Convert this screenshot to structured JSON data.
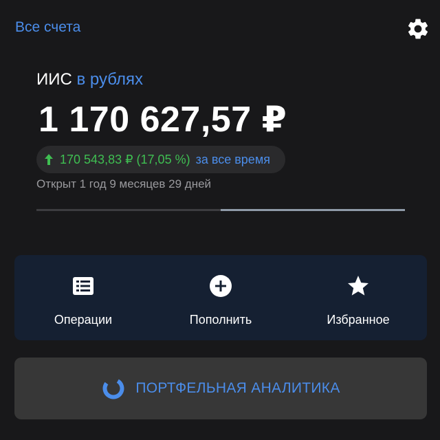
{
  "header": {
    "all_accounts_label": "Все счета",
    "settings_icon": "gear-icon"
  },
  "account": {
    "name": "ИИС",
    "currency_label": "в рублях",
    "balance": "1 170 627,57 ₽",
    "change": {
      "direction": "up",
      "value": "170 543,83 ₽ (17,05 %)",
      "period_label": "за все время",
      "color": "#3fbf52"
    },
    "opened_text": "Открыт 1 год 9 месяцев 29 дней",
    "progress_fraction": 0.5
  },
  "actions": [
    {
      "label": "Операции",
      "icon": "list-icon"
    },
    {
      "label": "Пополнить",
      "icon": "plus-circle-icon"
    },
    {
      "label": "Избранное",
      "icon": "star-icon"
    }
  ],
  "analytics": {
    "label": "ПОРТФЕЛЬНАЯ АНАЛИТИКА",
    "icon": "donut-chart-icon"
  },
  "colors": {
    "accent": "#4b8dea",
    "positive": "#3fbf52",
    "background": "#18181a",
    "actions_panel": "#152032",
    "analytics_button": "#373737"
  }
}
